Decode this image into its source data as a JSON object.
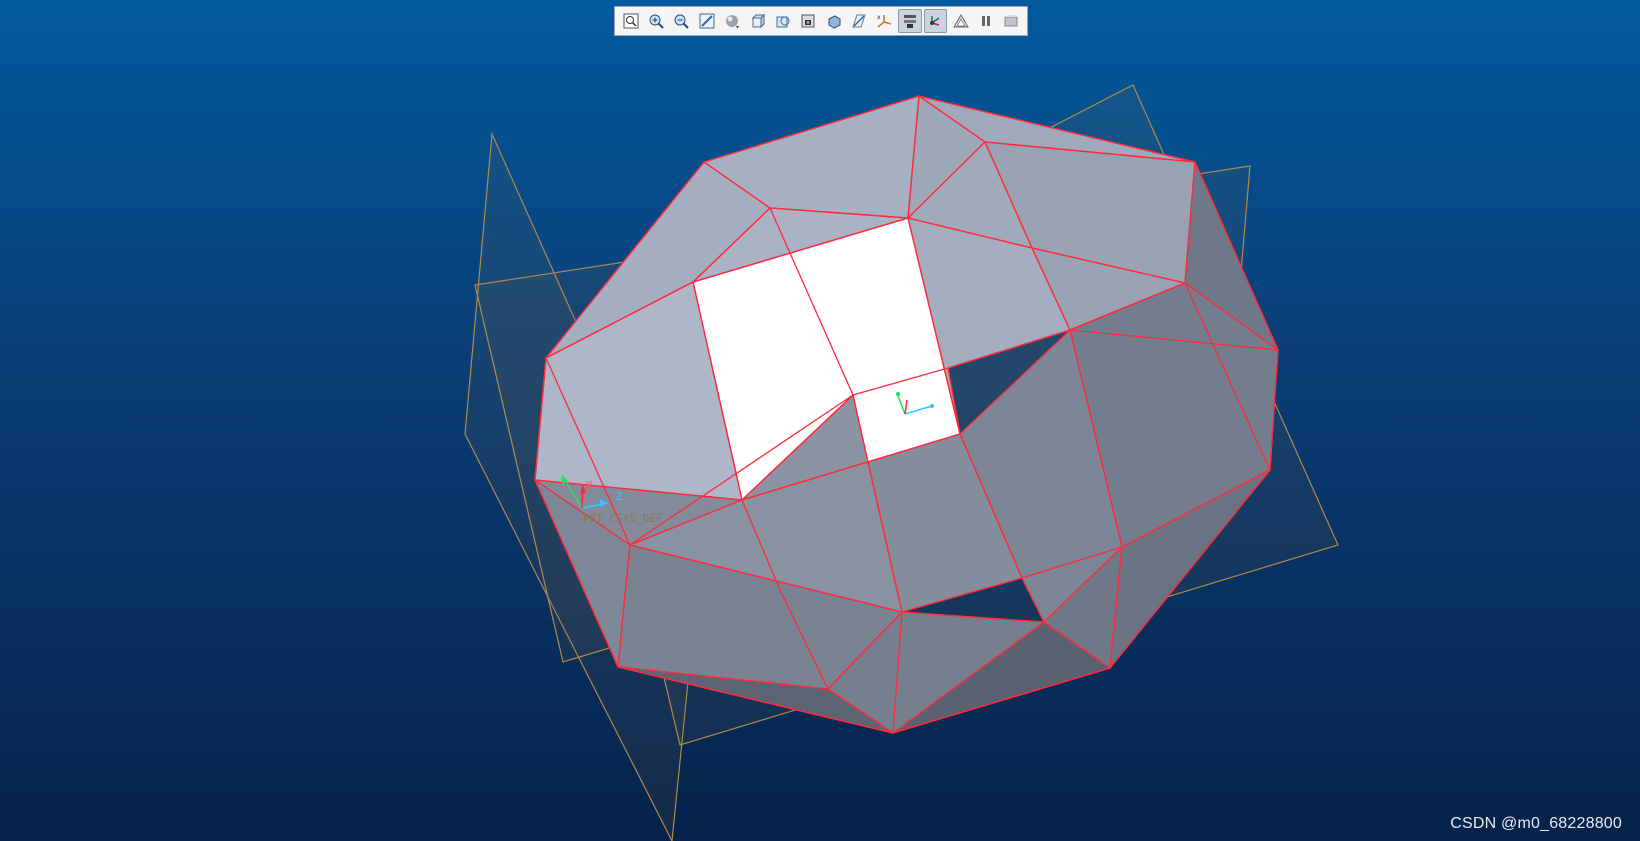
{
  "toolbar": {
    "buttons": [
      {
        "name": "refit-icon",
        "label": "Refit",
        "active": false
      },
      {
        "name": "zoom-in-icon",
        "label": "Zoom In",
        "active": false
      },
      {
        "name": "zoom-out-icon",
        "label": "Zoom Out",
        "active": false
      },
      {
        "name": "repaint-icon",
        "label": "Repaint",
        "active": false
      },
      {
        "name": "display-style-icon",
        "label": "Display Style",
        "active": false
      },
      {
        "name": "saved-orientations-icon",
        "label": "Saved Orientations",
        "active": false
      },
      {
        "name": "view-manager-icon",
        "label": "View Manager",
        "active": false
      },
      {
        "name": "perspective-icon",
        "label": "Perspective View",
        "active": false
      },
      {
        "name": "section-icon",
        "label": "Section",
        "active": false
      },
      {
        "name": "datum-display-icon",
        "label": "Datum Display Filters",
        "active": false
      },
      {
        "name": "csys-display-icon",
        "label": "Coordinate System Display",
        "active": false
      },
      {
        "name": "annotation-display-icon",
        "label": "Annotation Display",
        "active": true
      },
      {
        "name": "spin-center-icon",
        "label": "Spin Center",
        "active": true
      },
      {
        "name": "appearance-icon",
        "label": "Appearance",
        "active": false
      },
      {
        "name": "pause-icon",
        "label": "Pause",
        "active": false
      },
      {
        "name": "annotation-orientation-icon",
        "label": "Annotation Orientation",
        "active": false
      }
    ]
  },
  "model": {
    "csys_name": "PRT_CSYS_DEF",
    "csys_axes": {
      "x": "X",
      "y": "Y",
      "z": "Z"
    },
    "edge_color": "#ff2a3a",
    "datum_plane_color": "#b08a4a"
  },
  "watermark": "CSDN @m0_68228800"
}
